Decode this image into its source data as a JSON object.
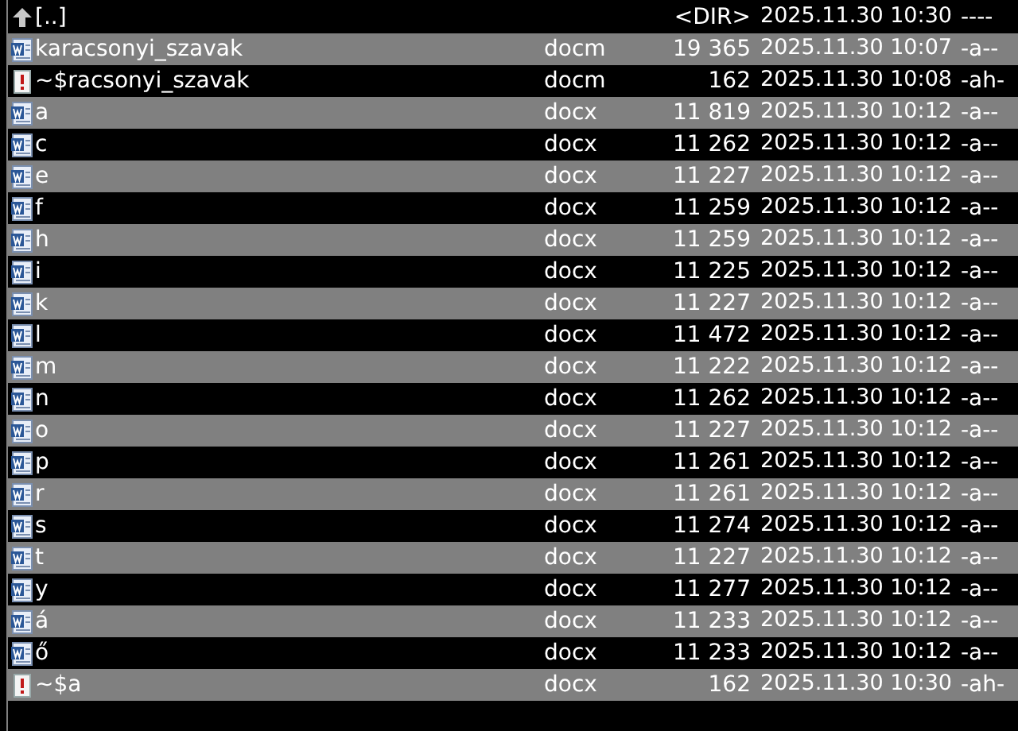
{
  "files": [
    {
      "kind": "up",
      "name": "[..]",
      "size": "<DIR>",
      "date": "2025.11.30 10:30",
      "attr": "----"
    },
    {
      "kind": "word",
      "name": "karacsonyi_szavak",
      "ext": "docm",
      "size": "19 365",
      "date": "2025.11.30 10:07",
      "attr": "-a--"
    },
    {
      "kind": "temp",
      "name": "~$racsonyi_szavak",
      "ext": "docm",
      "size": "162",
      "date": "2025.11.30 10:08",
      "attr": "-ah-"
    },
    {
      "kind": "word",
      "name": "a",
      "ext": "docx",
      "size": "11 819",
      "date": "2025.11.30 10:12",
      "attr": "-a--"
    },
    {
      "kind": "word",
      "name": "c",
      "ext": "docx",
      "size": "11 262",
      "date": "2025.11.30 10:12",
      "attr": "-a--"
    },
    {
      "kind": "word",
      "name": "e",
      "ext": "docx",
      "size": "11 227",
      "date": "2025.11.30 10:12",
      "attr": "-a--"
    },
    {
      "kind": "word",
      "name": "f",
      "ext": "docx",
      "size": "11 259",
      "date": "2025.11.30 10:12",
      "attr": "-a--"
    },
    {
      "kind": "word",
      "name": "h",
      "ext": "docx",
      "size": "11 259",
      "date": "2025.11.30 10:12",
      "attr": "-a--"
    },
    {
      "kind": "word",
      "name": "i",
      "ext": "docx",
      "size": "11 225",
      "date": "2025.11.30 10:12",
      "attr": "-a--"
    },
    {
      "kind": "word",
      "name": "k",
      "ext": "docx",
      "size": "11 227",
      "date": "2025.11.30 10:12",
      "attr": "-a--"
    },
    {
      "kind": "word",
      "name": "l",
      "ext": "docx",
      "size": "11 472",
      "date": "2025.11.30 10:12",
      "attr": "-a--"
    },
    {
      "kind": "word",
      "name": "m",
      "ext": "docx",
      "size": "11 222",
      "date": "2025.11.30 10:12",
      "attr": "-a--"
    },
    {
      "kind": "word",
      "name": "n",
      "ext": "docx",
      "size": "11 262",
      "date": "2025.11.30 10:12",
      "attr": "-a--"
    },
    {
      "kind": "word",
      "name": "o",
      "ext": "docx",
      "size": "11 227",
      "date": "2025.11.30 10:12",
      "attr": "-a--"
    },
    {
      "kind": "word",
      "name": "p",
      "ext": "docx",
      "size": "11 261",
      "date": "2025.11.30 10:12",
      "attr": "-a--"
    },
    {
      "kind": "word",
      "name": "r",
      "ext": "docx",
      "size": "11 261",
      "date": "2025.11.30 10:12",
      "attr": "-a--"
    },
    {
      "kind": "word",
      "name": "s",
      "ext": "docx",
      "size": "11 274",
      "date": "2025.11.30 10:12",
      "attr": "-a--"
    },
    {
      "kind": "word",
      "name": "t",
      "ext": "docx",
      "size": "11 227",
      "date": "2025.11.30 10:12",
      "attr": "-a--"
    },
    {
      "kind": "word",
      "name": "y",
      "ext": "docx",
      "size": "11 277",
      "date": "2025.11.30 10:12",
      "attr": "-a--"
    },
    {
      "kind": "word",
      "name": "á",
      "ext": "docx",
      "size": "11 233",
      "date": "2025.11.30 10:12",
      "attr": "-a--"
    },
    {
      "kind": "word",
      "name": "ő",
      "ext": "docx",
      "size": "11 233",
      "date": "2025.11.30 10:12",
      "attr": "-a--"
    },
    {
      "kind": "temp",
      "name": "~$a",
      "ext": "docx",
      "size": "162",
      "date": "2025.11.30 10:30",
      "attr": "-ah-"
    }
  ]
}
